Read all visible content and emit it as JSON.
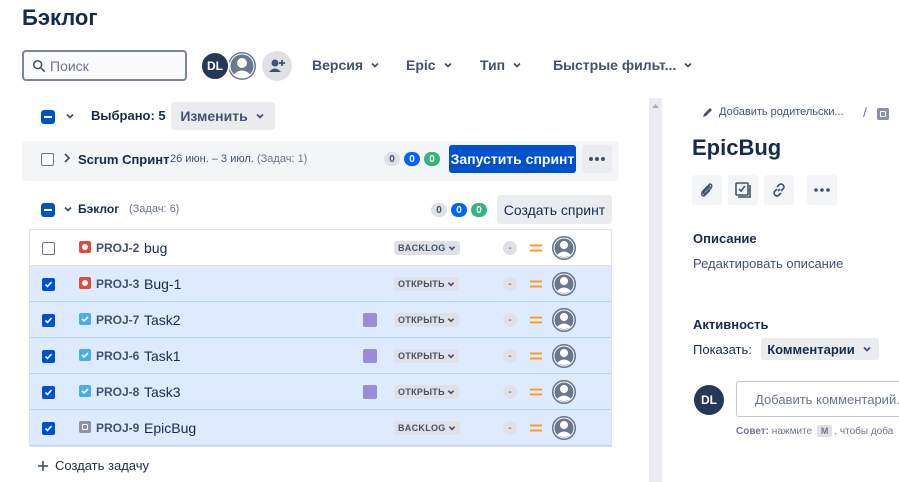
{
  "page": {
    "title": "Бэклог"
  },
  "search": {
    "placeholder": "Поиск",
    "value": ""
  },
  "avatars": {
    "user_initials": "DL"
  },
  "filters": [
    {
      "label": "Версия"
    },
    {
      "label": "Epic"
    },
    {
      "label": "Тип"
    },
    {
      "label": "Быстрые фильт..."
    }
  ],
  "selection": {
    "label": "Выбрано: 5",
    "change_button": "Изменить"
  },
  "sprint": {
    "name": "Scrum Спринт",
    "dates": "26 июн. – 3 июл.",
    "issues": "(Задач: 1)",
    "counts": [
      "0",
      "0",
      "0"
    ],
    "start_button": "Запустить спринт"
  },
  "backlog": {
    "name": "Бэклог",
    "issues": "(Задач: 6)",
    "counts": [
      "0",
      "0",
      "0"
    ],
    "create_sprint_button": "Создать спринт",
    "create_issue": "Создать задачу"
  },
  "rows": [
    {
      "key": "PROJ-2",
      "summary": "bug",
      "type": "bug",
      "status": "BACKLOG",
      "estimate": "-",
      "selected": false,
      "epic": false
    },
    {
      "key": "PROJ-3",
      "summary": "Bug-1",
      "type": "bug",
      "status": "ОТКРЫТЬ",
      "estimate": "-",
      "selected": true,
      "epic": false
    },
    {
      "key": "PROJ-7",
      "summary": "Task2",
      "type": "task",
      "status": "ОТКРЫТЬ",
      "estimate": "-",
      "selected": true,
      "epic": true
    },
    {
      "key": "PROJ-6",
      "summary": "Task1",
      "type": "task",
      "status": "ОТКРЫТЬ",
      "estimate": "-",
      "selected": true,
      "epic": true
    },
    {
      "key": "PROJ-8",
      "summary": "Task3",
      "type": "task",
      "status": "ОТКРЫТЬ",
      "estimate": "-",
      "selected": true,
      "epic": true
    },
    {
      "key": "PROJ-9",
      "summary": "EpicBug",
      "type": "other",
      "status": "BACKLOG",
      "estimate": "-",
      "selected": true,
      "epic": false
    }
  ],
  "detail": {
    "add_parent": "Добавить родительски...",
    "separator": "/",
    "title": "EpicBug",
    "description_heading": "Описание",
    "description_placeholder": "Редактировать описание",
    "activity_heading": "Активность",
    "show_label": "Показать:",
    "show_value": "Комментарии",
    "comment_avatar": "DL",
    "comment_placeholder": "Добавить комментарий...",
    "tip_bold": "Совет:",
    "tip_text_before": " нажмите ",
    "tip_key": "M",
    "tip_text_after": ", чтобы доба"
  },
  "colors": {
    "primary": "#0052cc",
    "selected_row": "#deebff",
    "bug": "#e5493a",
    "task": "#4bade8",
    "epic": "#998dd9",
    "priority": "#ff991f",
    "done_green": "#36b37e"
  }
}
